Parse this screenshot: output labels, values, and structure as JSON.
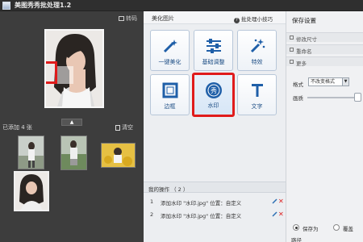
{
  "window": {
    "title": "美图秀秀批处理1.2"
  },
  "left": {
    "rotate_label": "转码",
    "added_count": "已添加 4 张",
    "clear_label": "清空",
    "collapse_glyph": "▲"
  },
  "middle": {
    "section_title": "美化图片",
    "tips_label": "批处理小技巧",
    "tools": [
      {
        "label": "一键美化",
        "icon": "magic-wand-icon"
      },
      {
        "label": "基础调整",
        "icon": "sliders-icon"
      },
      {
        "label": "特效",
        "icon": "sparkle-wand-icon"
      },
      {
        "label": "边框",
        "icon": "frame-icon"
      },
      {
        "label": "水印",
        "icon": "watermark-icon",
        "selected": true
      },
      {
        "label": "文字",
        "icon": "text-icon"
      }
    ],
    "ops_title": "我的操作 （ 2 ）",
    "operations": [
      {
        "num": "1",
        "text": "添加水印 \"水印.jpg\" 位置：自定义"
      },
      {
        "num": "2",
        "text": "添加水印 \"水印.jpg\" 位置：自定义"
      }
    ]
  },
  "right": {
    "save_title": "保存设置",
    "rows": [
      "修改尺寸",
      "重命名",
      "更多"
    ],
    "format_label": "格式",
    "format_value": "不改变格式",
    "quality_label": "画质",
    "radio1_label": "保存为",
    "radio2_label": "覆盖",
    "path_label": "路径"
  },
  "colors": {
    "highlight_red": "#e01b1b",
    "tool_blue": "#1f5fa8"
  }
}
